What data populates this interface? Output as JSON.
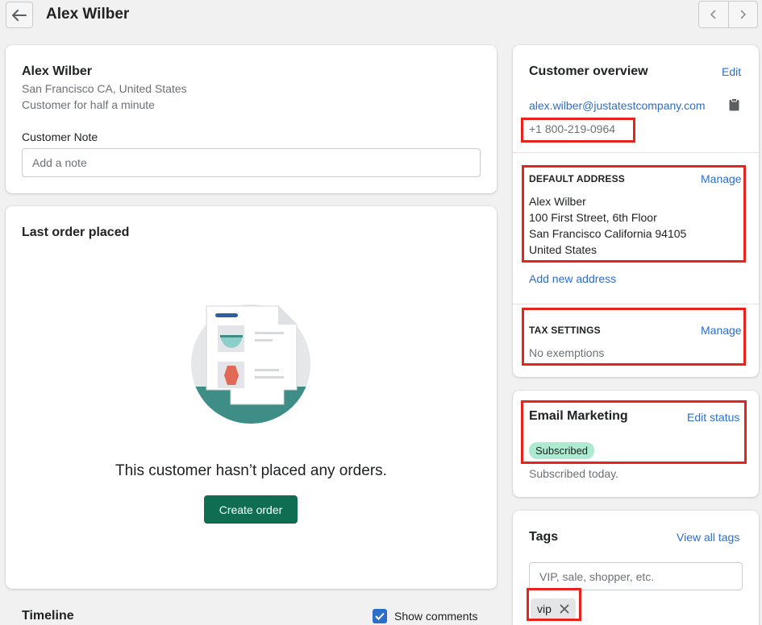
{
  "header": {
    "title": "Alex Wilber"
  },
  "customer": {
    "name": "Alex Wilber",
    "location": "San Francisco CA, United States",
    "tenure": "Customer for half a minute",
    "note_label": "Customer Note",
    "note_placeholder": "Add a note"
  },
  "last_order": {
    "title": "Last order placed",
    "empty_message": "This customer hasn’t placed any orders.",
    "create_button": "Create order"
  },
  "timeline": {
    "title": "Timeline",
    "show_comments_label": "Show comments",
    "show_comments_checked": true
  },
  "overview": {
    "title": "Customer overview",
    "edit_label": "Edit",
    "email": "alex.wilber@justatestcompany.com",
    "phone": "+1 800-219-0964",
    "default_address": {
      "heading": "DEFAULT ADDRESS",
      "manage_label": "Manage",
      "lines": [
        "Alex Wilber",
        "100 First Street, 6th Floor",
        "San Francisco California 94105",
        "United States"
      ],
      "add_new_label": "Add new address"
    },
    "tax": {
      "heading": "TAX SETTINGS",
      "manage_label": "Manage",
      "value": "No exemptions"
    }
  },
  "email_marketing": {
    "title": "Email Marketing",
    "edit_label": "Edit status",
    "status_badge": "Subscribed",
    "status_detail": "Subscribed today."
  },
  "tags": {
    "title": "Tags",
    "view_all_label": "View all tags",
    "placeholder": "VIP, sale, shopper, etc.",
    "items": [
      "vip"
    ]
  },
  "colors": {
    "primary": "#0f6e52",
    "link": "#2c6ecb",
    "highlight": "#e8231b",
    "badge": "#aee9d1"
  }
}
